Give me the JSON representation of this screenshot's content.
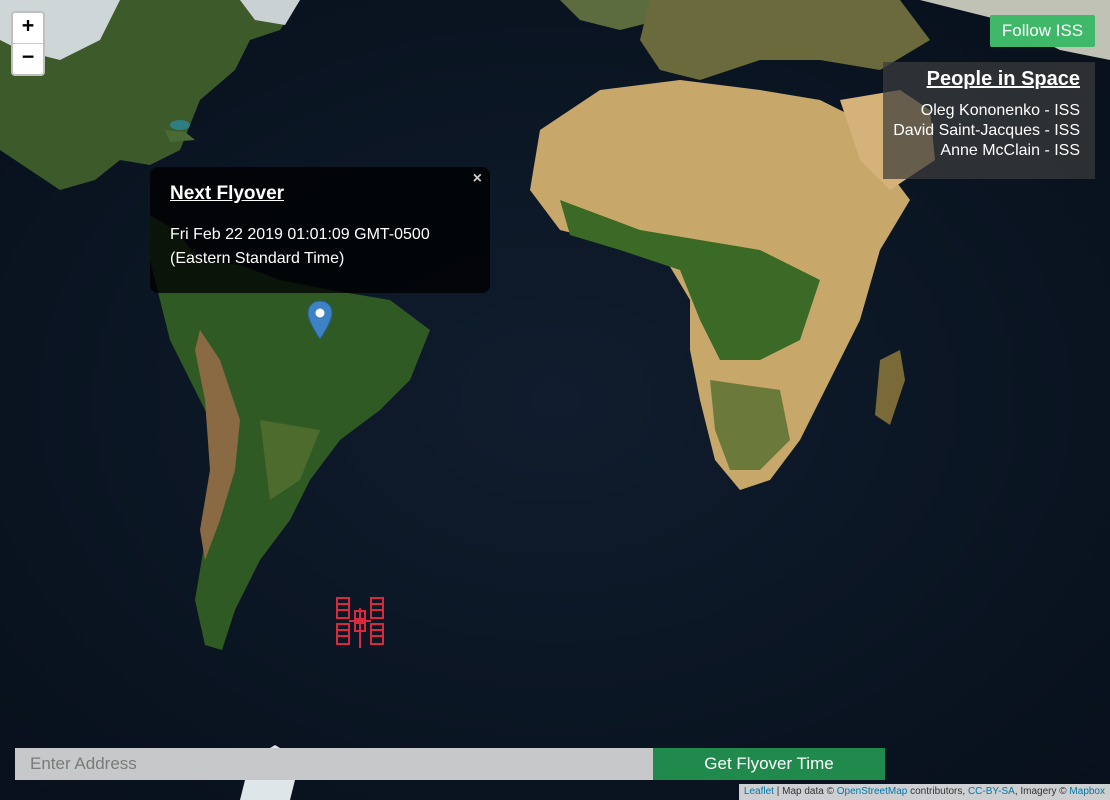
{
  "map": {
    "zoom_in_label": "+",
    "zoom_out_label": "−",
    "ocean_color": "#0b1624"
  },
  "follow_button": {
    "label": "Follow ISS",
    "color": "#3fb86a"
  },
  "people_panel": {
    "title": "People in Space",
    "people": [
      "Oleg Kononenko - ISS",
      "David Saint-Jacques - ISS",
      "Anne McClain - ISS"
    ]
  },
  "popup": {
    "title": "Next Flyover",
    "close_label": "×",
    "line1": "Fri Feb 22 2019 01:01:09 GMT-0500",
    "line2": "(Eastern Standard Time)"
  },
  "markers": {
    "location_pin_icon": "map-pin-icon",
    "location_pin_color": "#3d82c4",
    "iss_icon": "space-station-icon",
    "iss_color": "#d8293f"
  },
  "search": {
    "placeholder": "Enter Address"
  },
  "submit": {
    "label": "Get Flyover Time",
    "color": "#1f8a4c"
  },
  "attribution": {
    "leaflet": "Leaflet",
    "sep1": " | Map data © ",
    "osm": "OpenStreetMap",
    "contrib": " contributors, ",
    "license": "CC-BY-SA",
    "imagery": ", Imagery © ",
    "mapbox": "Mapbox"
  }
}
